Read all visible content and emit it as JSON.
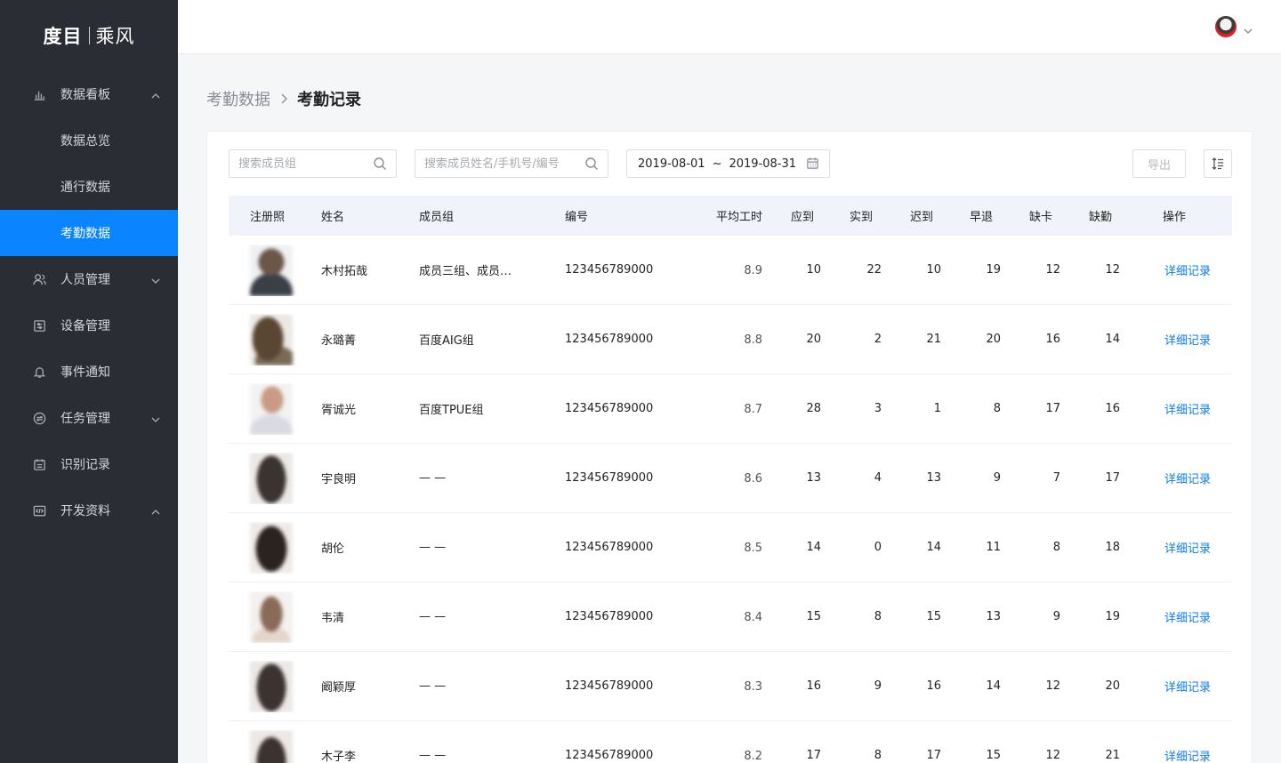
{
  "logo": {
    "brand": "度目",
    "product": "乘风"
  },
  "sidebar": {
    "items": [
      {
        "label": "数据看板",
        "icon": "bar-chart-icon",
        "expanded": true
      },
      {
        "label": "数据总览"
      },
      {
        "label": "通行数据"
      },
      {
        "label": "考勤数据",
        "active": true
      },
      {
        "label": "人员管理",
        "icon": "users-icon",
        "expanded": false
      },
      {
        "label": "设备管理",
        "icon": "device-icon"
      },
      {
        "label": "事件通知",
        "icon": "bell-icon"
      },
      {
        "label": "任务管理",
        "icon": "task-icon",
        "expanded": false
      },
      {
        "label": "识别记录",
        "icon": "calendar-icon"
      },
      {
        "label": "开发资料",
        "icon": "code-icon",
        "expanded": true
      }
    ]
  },
  "breadcrumb": {
    "parent": "考勤数据",
    "current": "考勤记录"
  },
  "toolbar": {
    "group_placeholder": "搜索成员组",
    "member_placeholder": "搜索成员姓名/手机号/编号",
    "date_start": "2019-08-01",
    "date_sep": "~",
    "date_end": "2019-08-31",
    "export_label": "导出"
  },
  "table": {
    "headers": [
      "注册照",
      "姓名",
      "成员组",
      "编号",
      "平均工时",
      "应到",
      "实到",
      "迟到",
      "早退",
      "缺卡",
      "缺勤",
      "操作"
    ],
    "rows": [
      {
        "name": "木村拓哉",
        "group": "成员三组、成员…",
        "code": "123456789000",
        "avg": "8.9",
        "n1": "10",
        "n2": "22",
        "n3": "10",
        "n4": "19",
        "n5": "12",
        "n6": "12",
        "op": "详细记录"
      },
      {
        "name": "永璐菁",
        "group": "百度AIG组",
        "code": "123456789000",
        "avg": "8.8",
        "n1": "20",
        "n2": "2",
        "n3": "21",
        "n4": "20",
        "n5": "16",
        "n6": "14",
        "op": "详细记录"
      },
      {
        "name": "胥诚光",
        "group": "百度TPUE组",
        "code": "123456789000",
        "avg": "8.7",
        "n1": "28",
        "n2": "3",
        "n3": "1",
        "n4": "8",
        "n5": "17",
        "n6": "16",
        "op": "详细记录"
      },
      {
        "name": "宇良明",
        "group": "— —",
        "code": "123456789000",
        "avg": "8.6",
        "n1": "13",
        "n2": "4",
        "n3": "13",
        "n4": "9",
        "n5": "7",
        "n6": "17",
        "op": "详细记录"
      },
      {
        "name": "胡伦",
        "group": "— —",
        "code": "123456789000",
        "avg": "8.5",
        "n1": "14",
        "n2": "0",
        "n3": "14",
        "n4": "11",
        "n5": "8",
        "n6": "18",
        "op": "详细记录"
      },
      {
        "name": "韦清",
        "group": "— —",
        "code": "123456789000",
        "avg": "8.4",
        "n1": "15",
        "n2": "8",
        "n3": "15",
        "n4": "13",
        "n5": "9",
        "n6": "19",
        "op": "详细记录"
      },
      {
        "name": "阚颖厚",
        "group": "— —",
        "code": "123456789000",
        "avg": "8.3",
        "n1": "16",
        "n2": "9",
        "n3": "16",
        "n4": "14",
        "n5": "12",
        "n6": "20",
        "op": "详细记录"
      },
      {
        "name": "木子李",
        "group": "— —",
        "code": "123456789000",
        "avg": "8.2",
        "n1": "17",
        "n2": "8",
        "n3": "17",
        "n4": "15",
        "n5": "12",
        "n6": "21",
        "op": "详细记录"
      }
    ]
  },
  "colors": {
    "accent": "#0b84ff",
    "sidebar_bg": "#2b2d34",
    "link": "#0b7bff"
  }
}
